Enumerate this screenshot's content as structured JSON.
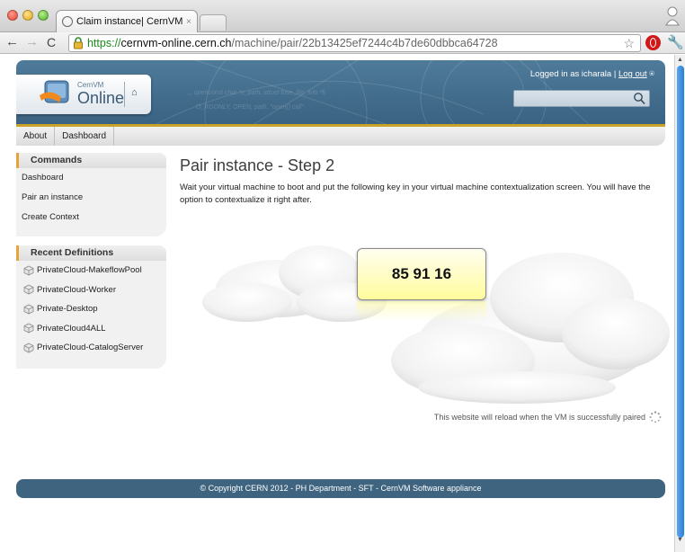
{
  "browser": {
    "tab_title": "Claim instance| CernVM Onli",
    "tab_close": "×",
    "url_scheme": "https://",
    "url_host": "cernvm-online.cern.ch",
    "url_path": "/machine/pair/22b13425ef7244c4b7de60dbbca64728",
    "back_glyph": "←",
    "forward_glyph": "→",
    "reload_glyph": "C",
    "star_glyph": "☆",
    "wrench_glyph": "🔧",
    "icons": [
      "globe-icon",
      "lock-icon",
      "star-icon",
      "opera-icon",
      "wrench-icon",
      "profile-icon"
    ]
  },
  "header": {
    "logo_small": "CernVM",
    "logo_big": "Online",
    "home_glyph": "⌂",
    "logged_in_text": "Logged in as icharala |",
    "logout_label": "Log out",
    "logout_glyph": "⍟",
    "search_placeholder": "",
    "colors": {
      "header_blue": "#3a6282",
      "accent_gold": "#c9a227",
      "footer_blue": "#3f6480"
    }
  },
  "topnav": {
    "items": [
      "About",
      "Dashboard"
    ]
  },
  "sidebar": {
    "commands_title": "Commands",
    "commands": [
      "Dashboard",
      "Pair an instance",
      "Create Context"
    ],
    "recent_title": "Recent Definitions",
    "recent": [
      "PrivateCloud-MakeflowPool",
      "PrivateCloud-Worker",
      "Private-Desktop",
      "PrivateCloud4ALL",
      "PrivateCloud-CatalogServer"
    ]
  },
  "main": {
    "title": "Pair instance - Step 2",
    "intro": "Wait your virtual machine to boot and put the following key in your virtual machine contextualization screen. You will have the option to contextualize it right after.",
    "pairing_key": "85 91 16",
    "reload_note": "This website will reload when the VM is successfully paired"
  },
  "footer": {
    "text": "© Copyright CERN 2012 - PH Department - SFT - CernVM Software appliance"
  }
}
